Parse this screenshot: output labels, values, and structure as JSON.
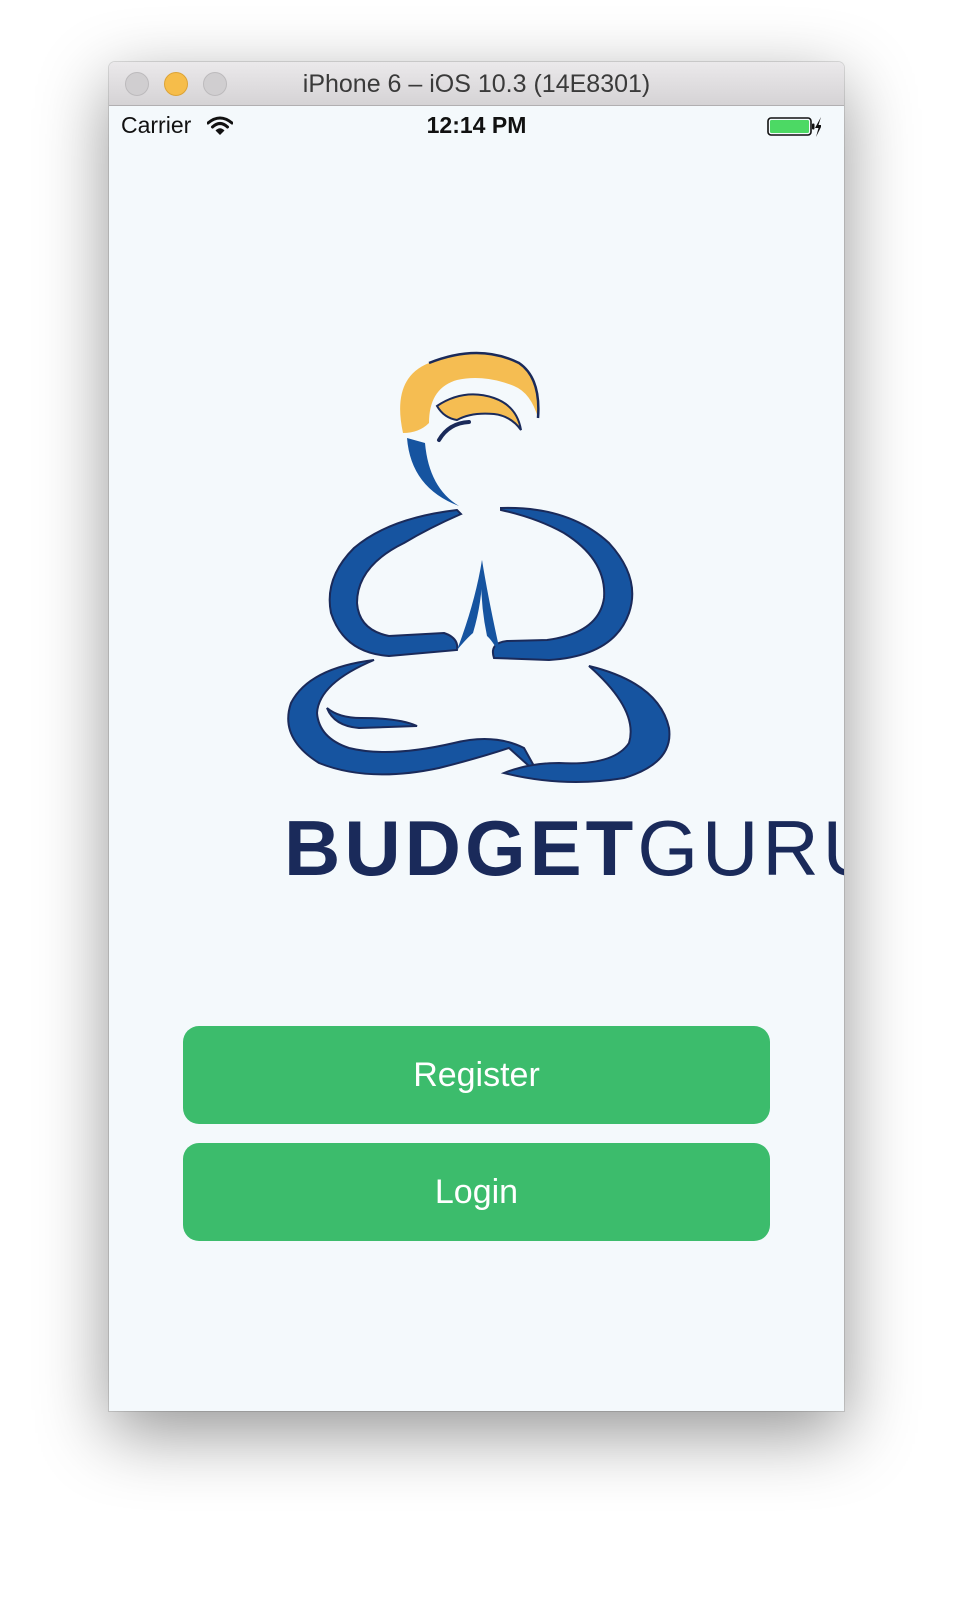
{
  "window": {
    "title": "iPhone 6 – iOS 10.3 (14E8301)"
  },
  "status_bar": {
    "carrier": "Carrier",
    "time": "12:14 PM",
    "wifi_icon": "wifi-icon",
    "battery_icon": "battery-charging-icon"
  },
  "logo": {
    "icon": "meditating-guru-logo",
    "text_bold": "BUDGET",
    "text_light": "GURU"
  },
  "buttons": {
    "register_label": "Register",
    "login_label": "Login"
  },
  "colors": {
    "background": "#f4f9fc",
    "button": "#3cbc6c",
    "logo_blue": "#1654a0",
    "logo_navy": "#1a2a5a",
    "logo_yellow": "#f5bd52",
    "battery_green": "#4cd964"
  }
}
